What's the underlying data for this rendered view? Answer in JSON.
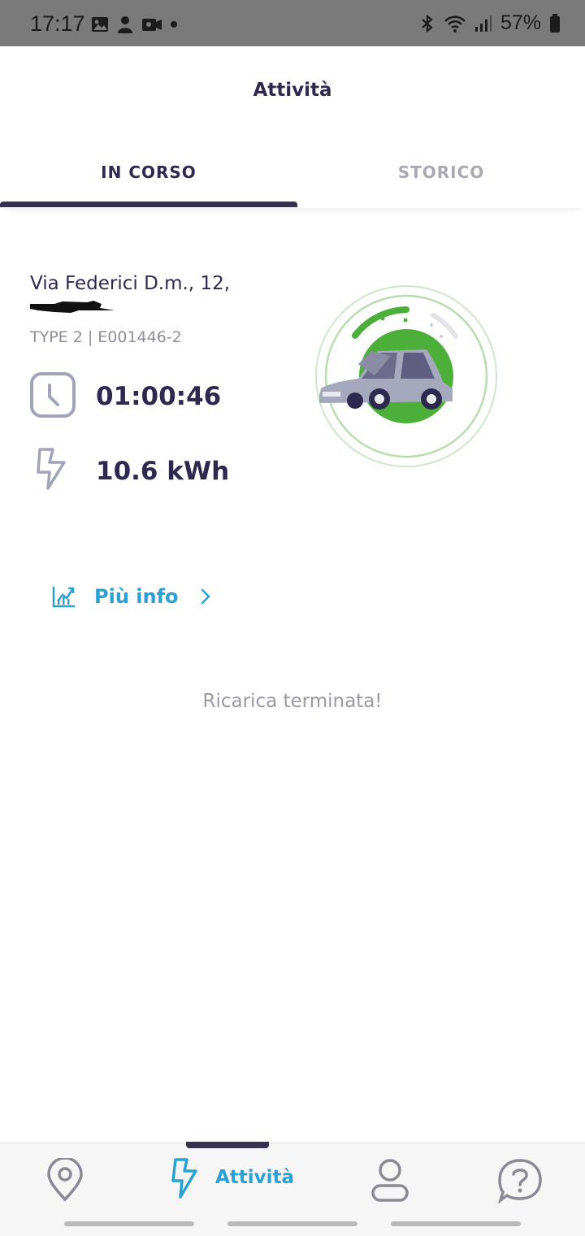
{
  "status_bar": {
    "time": "17:17",
    "battery": "57%",
    "icons": [
      "gallery-icon",
      "user-icon",
      "vpn-icon",
      "dot-icon",
      "bluetooth-icon",
      "wifi-icon",
      "signal-icon",
      "battery-icon"
    ]
  },
  "header": {
    "title": "Attività"
  },
  "tabs": [
    {
      "label": "IN CORSO",
      "active": true
    },
    {
      "label": "STORICO",
      "active": false
    }
  ],
  "session": {
    "address": "Via Federici D.m., 12,",
    "connector": "TYPE 2 | E001446-2",
    "duration": "01:00:46",
    "energy": "10.6 kWh"
  },
  "more_info": {
    "label": "Più info"
  },
  "status_message": "Ricarica terminata!",
  "bottom_nav": {
    "items": [
      {
        "icon": "location-pin-icon"
      },
      {
        "icon": "bolt-icon",
        "label": "Attività",
        "active": true
      },
      {
        "icon": "profile-icon"
      },
      {
        "icon": "help-icon"
      }
    ]
  },
  "colors": {
    "primary": "#2e2a4f",
    "accent": "#2aa0d3",
    "green": "#4caf3a",
    "muted": "#9a9aa6"
  }
}
